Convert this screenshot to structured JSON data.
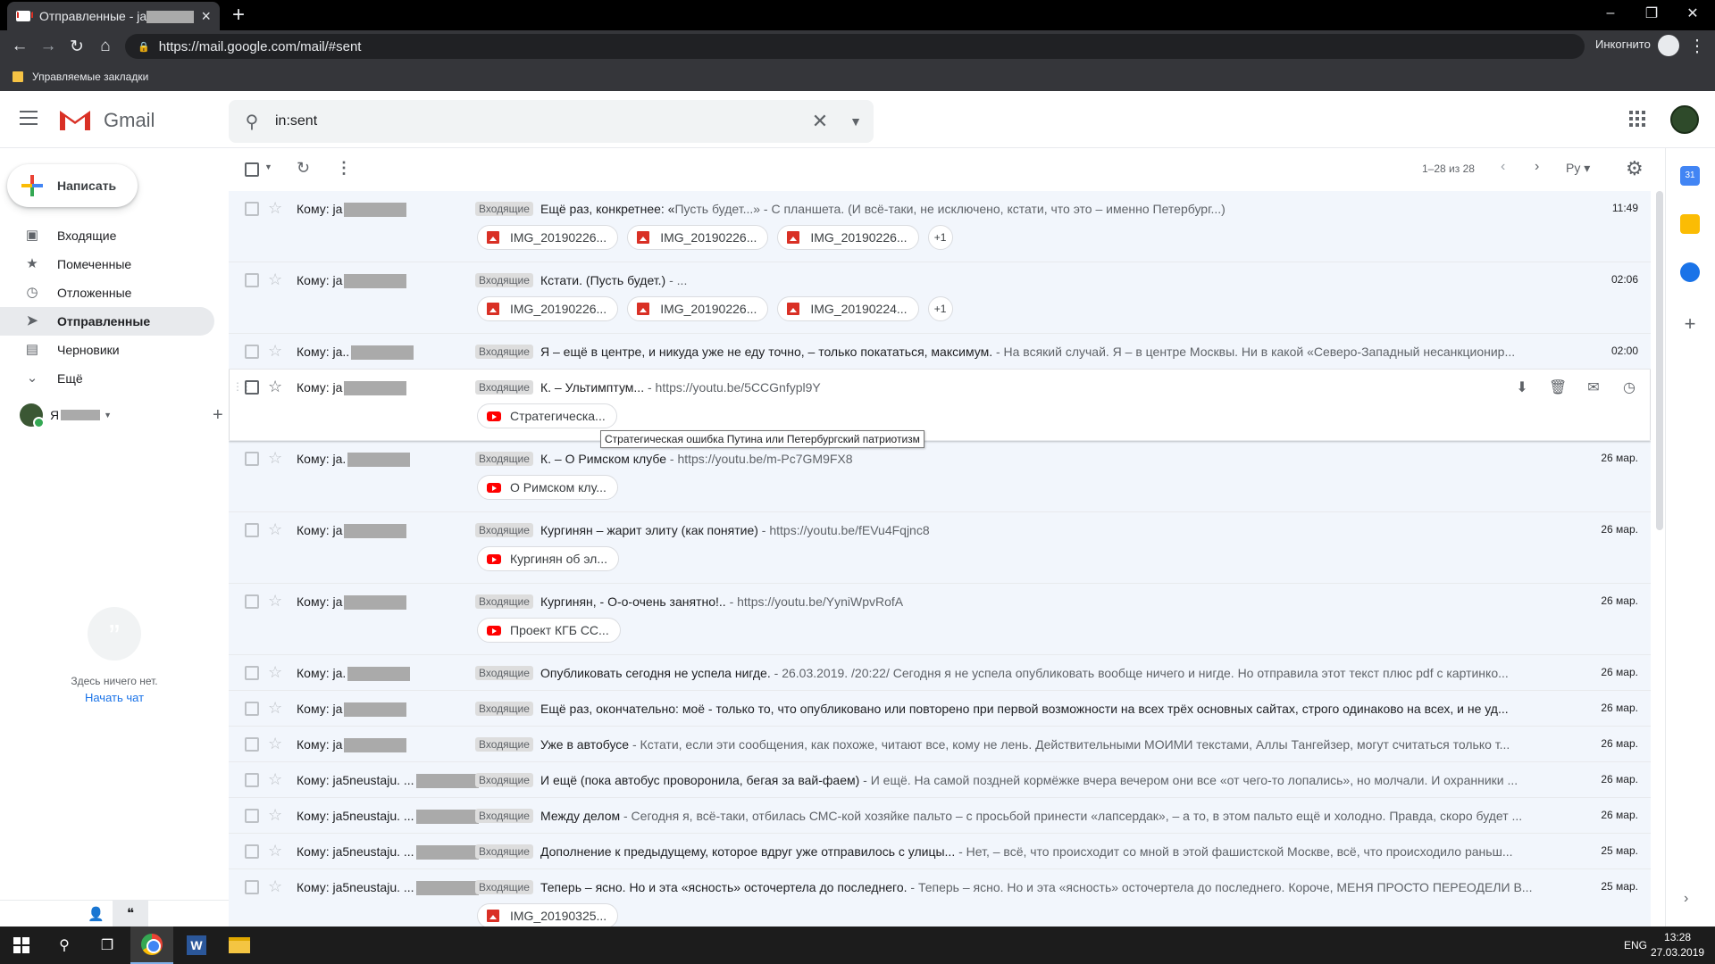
{
  "browser": {
    "tab_title": "Отправленные - ja",
    "url": "https://mail.google.com/mail/#sent",
    "incognito_label": "Инкогнито",
    "bookmarks_folder": "Управляемые закладки"
  },
  "gmail": {
    "app_name": "Gmail",
    "search_value": "in:sent",
    "compose_label": "Написать",
    "nav": [
      {
        "label": "Входящие",
        "icon": "inbox-icon"
      },
      {
        "label": "Помеченные",
        "icon": "star-icon"
      },
      {
        "label": "Отложенные",
        "icon": "clock-icon"
      },
      {
        "label": "Отправленные",
        "icon": "send-icon",
        "active": true
      },
      {
        "label": "Черновики",
        "icon": "draft-icon"
      },
      {
        "label": "Ещё",
        "icon": "chevron-down-icon"
      }
    ],
    "hangouts_user": "Я",
    "chat_empty": "Здесь ничего нет.",
    "chat_start": "Начать чат",
    "pager": "1–28 из 28",
    "lang": "Ру",
    "tooltip": "Стратегическая ошибка Путина или Петербургский патриотизм",
    "badge": "Входящие",
    "emails": [
      {
        "to": "Кому: ja",
        "subject": "Ещё раз, конкретнее: «",
        "snippet": "Пусть будет...» - С планшета. (И всё-таки, не исключено, кстати, что это – именно Петербург...)",
        "date": "11:49",
        "chips": [
          "IMG_20190226...",
          "IMG_20190226...",
          "IMG_20190226..."
        ],
        "chip_type": "img",
        "more": "+1"
      },
      {
        "to": "Кому: ja",
        "subject": "Кстати. (Пусть будет.)",
        "snippet": " - ...",
        "date": "02:06",
        "chips": [
          "IMG_20190226...",
          "IMG_20190226...",
          "IMG_20190224..."
        ],
        "chip_type": "img",
        "more": "+1"
      },
      {
        "to": "Кому: ja..",
        "subject": "Я – ещё в центре, и никуда уже не еду точно, – только покататься, максимум.",
        "snippet": " - На всякий случай. Я – в центре Москвы. Ни в какой «Северо-Западный несанкционир...",
        "date": "02:00"
      },
      {
        "to": "Кому: ja",
        "subject": "К. – Ультимптум...",
        "snippet": " - https://youtu.be/5CCGnfypl9Y",
        "date": "",
        "chips": [
          "Стратегическа..."
        ],
        "chip_type": "yt",
        "hover": true
      },
      {
        "to": "Кому: ja.",
        "subject": "К. – О Римском клубе",
        "snippet": " - https://youtu.be/m-Pc7GM9FX8",
        "date": "26 мар.",
        "chips": [
          "О Римском клу..."
        ],
        "chip_type": "yt"
      },
      {
        "to": "Кому: ja",
        "subject": "Кургинян – жарит элиту (как понятие)",
        "snippet": " - https://youtu.be/fEVu4Fqjnc8",
        "date": "26 мар.",
        "chips": [
          "Кургинян об эл..."
        ],
        "chip_type": "yt"
      },
      {
        "to": "Кому: ja",
        "subject": "Кургинян, - О-о-очень занятно!..",
        "snippet": " - https://youtu.be/YyniWpvRofA",
        "date": "26 мар.",
        "chips": [
          "Проект КГБ СС..."
        ],
        "chip_type": "yt"
      },
      {
        "to": "Кому: ja.",
        "subject": "Опубликовать сегодня не успела нигде.",
        "snippet": " - 26.03.2019. /20:22/ Сегодня я не успела опубликовать вообще ничего и нигде. Но отправила этот текст плюс pdf с картинко...",
        "date": "26 мар."
      },
      {
        "to": "Кому: ja",
        "subject": "Ещё раз, окончательно: моё - только то, что опубликовано или повторено при первой возможности на всех трёх основных сайтах, строго одинаково на всех, и не уд...",
        "snippet": "",
        "date": "26 мар."
      },
      {
        "to": "Кому: ja",
        "subject": "Уже в автобусе",
        "snippet": " - Кстати, если эти сообщения, как похоже, читают все, кому не лень. Действительными МОИМИ текстами, Аллы Тангейзер, могут считаться только т...",
        "date": "26 мар."
      },
      {
        "to": "Кому: ja5neustaju. ...",
        "subject": "И ещё (пока автобус проворонила, бегая за вай-фаем)",
        "snippet": " - И ещё. На самой поздней кормёжке вчера вечером они все «от чего-то лопались», но молчали. И охранники ...",
        "date": "26 мар."
      },
      {
        "to": "Кому: ja5neustaju. ...",
        "subject": "Между делом",
        "snippet": " - Сегодня я, всё-таки, отбилась СМС-кой хозяйке пальто – с просьбой принести «лапсердак», – а то, в этом пальто ещё и холодно. Правда, скоро будет ...",
        "date": "26 мар."
      },
      {
        "to": "Кому: ja5neustaju. ...",
        "subject": "Дополнение к предыдущему, которое вдруг уже отправилось с улицы...",
        "snippet": " - Нет, – всё, что происходит со мной в этой фашистской Москве, всё, что происходило раньш...",
        "date": "25 мар."
      },
      {
        "to": "Кому: ja5neustaju. ...",
        "subject": "Теперь – ясно. Но и эта «ясность» осточертела до последнего.",
        "snippet": " - Теперь – ясно. Но и эта «ясность» осточертела до последнего. Короче, МЕНЯ ПРОСТО ПЕРЕОДЕЛИ В...",
        "date": "25 мар.",
        "chips": [
          "IMG_20190325..."
        ],
        "chip_type": "img"
      }
    ]
  },
  "taskbar": {
    "lang": "ENG",
    "time": "13:28",
    "date": "27.03.2019"
  }
}
